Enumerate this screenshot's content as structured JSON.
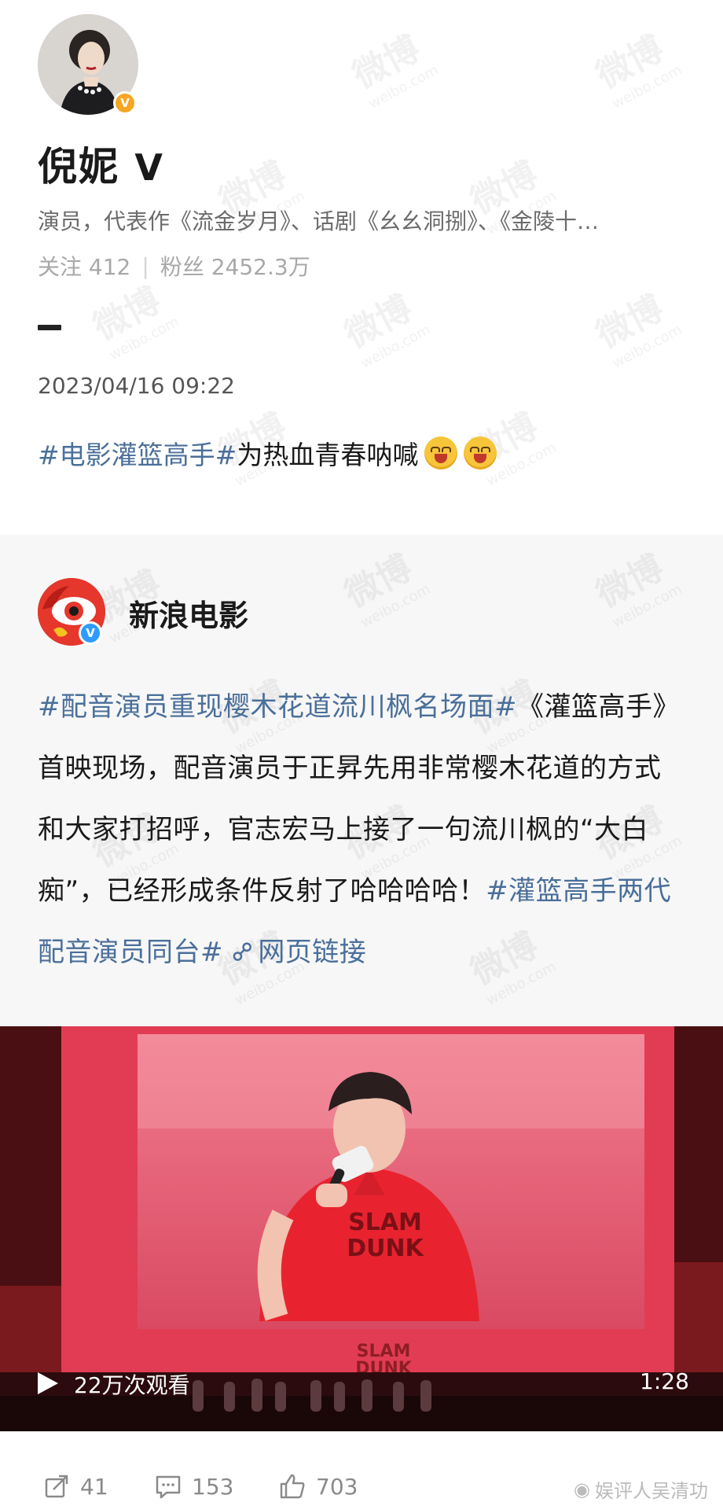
{
  "author": {
    "name": "倪妮",
    "verified_mark": "V",
    "bio": "演员，代表作《流金岁月》、话剧《幺幺洞捌》、《金陵十…",
    "following_label": "关注",
    "following_count": "412",
    "followers_label": "粉丝",
    "followers_count": "2452.3万",
    "avatar_icon": "woman-portrait-avatar",
    "badge_color": "#f5a623"
  },
  "post": {
    "timestamp": "2023/04/16 09:22",
    "hashtag": "#电影灌篮高手#",
    "text": " 为热血青春呐喊",
    "emoji_icon": "laughing-tears-emoji"
  },
  "repost": {
    "source_name": "新浪电影",
    "source_avatar_icon": "sina-weibo-eye-logo",
    "badge_color": "#2f9bff",
    "hashtag_1": "#配音演员重现樱木花道流川枫名场面#",
    "body": "《灌篮高手》首映现场，配音演员于正昇先用非常樱木花道的方式和大家打招呼，官志宏马上接了一句流川枫的“大白痴”，已经形成条件反射了哈哈哈哈！",
    "hashtag_2": "#灌篮高手两代配音演员同台#",
    "link_icon": "link-icon",
    "link_text": "网页链接",
    "tag_color": "#4a6f9a"
  },
  "video": {
    "views": "22万次观看",
    "duration": "1:28",
    "shirt_text_1": "SLAM",
    "shirt_text_2": "DUNK",
    "screen_logo_1": "SLAM",
    "screen_logo_2": "DUNK"
  },
  "actions": {
    "repost_count": "41",
    "comment_count": "153",
    "like_count": "703"
  },
  "watermark": {
    "main": "微博",
    "sub": "weibo.com",
    "credit": "娱评人吴清功"
  }
}
